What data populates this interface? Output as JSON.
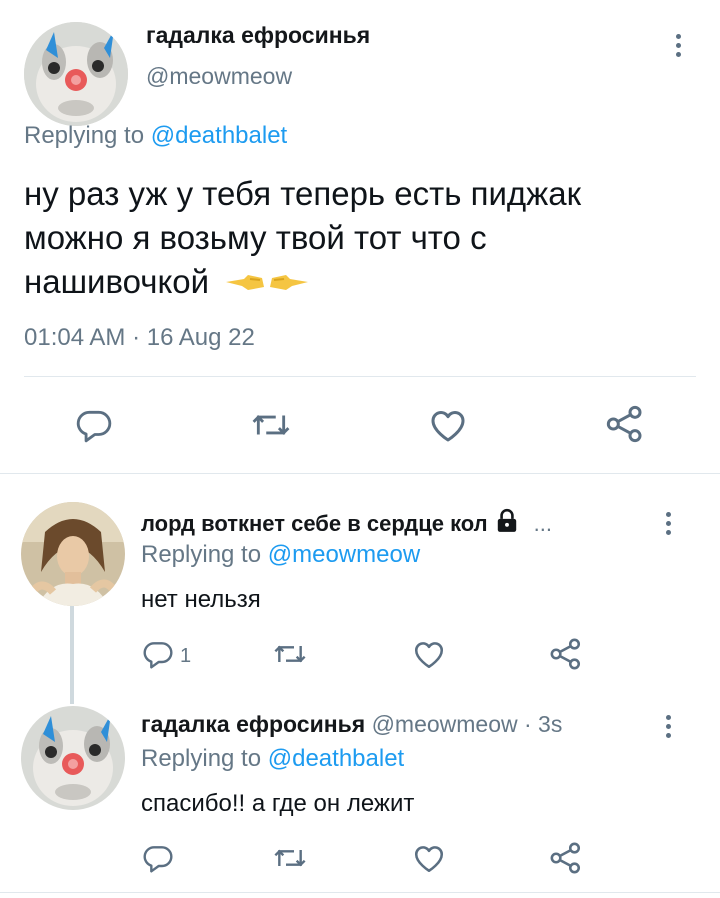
{
  "main_tweet": {
    "display_name": "гадалка ефросинья",
    "handle": "@meowmeow",
    "replying_prefix": "Replying to",
    "replying_to": "@deathbalet",
    "text_lines": [
      "ну раз уж у тебя теперь есть пиджак",
      "можно я возьму твой тот что с",
      "нашивочкой"
    ],
    "emoji": "👉👈",
    "timestamp": "01:04 AM · 16 Aug 22"
  },
  "reply_1": {
    "display_name": "лорд воткнет себе в сердце кол",
    "lock_icon": "lock-icon",
    "ellipsis": "...",
    "replying_prefix": "Replying to",
    "replying_to": "@meowmeow",
    "text": "нет нельзя",
    "reply_count": "1"
  },
  "reply_2": {
    "display_name": "гадалка ефросинья",
    "handle_time": "@meowmeow · 3s",
    "replying_prefix": "Replying to",
    "replying_to": "@deathbalet",
    "text": "спасибо!! а где он лежит"
  },
  "colors": {
    "link": "#1d9bf0",
    "muted": "#657786",
    "icon": "#5b6f82",
    "divider": "#e1e8ed"
  }
}
